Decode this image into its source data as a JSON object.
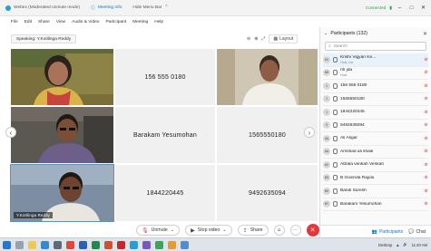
{
  "titlebar": {
    "app_title": "Webex (Moderated unmute mode)",
    "meeting_info": "Meeting Info",
    "hide_menu": "Hide Menu Bar",
    "connected": "Connected",
    "min": "–",
    "max": "□",
    "close": "✕"
  },
  "menubar": {
    "items": [
      "File",
      "Edit",
      "Share",
      "View",
      "Audio & Video",
      "Participant",
      "Meeting",
      "Help"
    ]
  },
  "speaking": "Speaking: Y.Kotilinga Reddy",
  "video_tools": {
    "layout": "Layout"
  },
  "tiles": {
    "t1_label": "",
    "t2_label": "156 555 0180",
    "t3_label": "",
    "t4_label": "Barakam Yesumohan",
    "t5_label": "1565550180",
    "t6_label": "",
    "t7_label": "1844220445",
    "t8_label": "9492635094",
    "active_name": "Y.Kotilinga Reddy"
  },
  "participants": {
    "header": "Participants (132)",
    "search_placeholder": "Search",
    "list": [
      {
        "initials": "KV",
        "name": "Krishi Vigyan Ke...",
        "sub": "Host, me",
        "highlight": true
      },
      {
        "initials": "NR",
        "name": "nh jda",
        "sub": "Host",
        "highlight": false
      },
      {
        "initials": "1",
        "name": "156 555 0180",
        "sub": "",
        "highlight": false
      },
      {
        "initials": "1",
        "name": "1565550180",
        "sub": "",
        "highlight": false
      },
      {
        "initials": "1",
        "name": "1844220445",
        "sub": "",
        "highlight": false
      },
      {
        "initials": "9",
        "name": "9492635094",
        "sub": "",
        "highlight": false
      },
      {
        "initials": "AA",
        "name": "Ali Asgar",
        "sub": "",
        "highlight": false
      },
      {
        "initials": "AA",
        "name": "Amshad ali shaik",
        "sub": "",
        "highlight": false
      },
      {
        "initials": "AV",
        "name": "Attrala venkah Venkah",
        "sub": "",
        "highlight": false
      },
      {
        "initials": "BG",
        "name": "B Govinda Rajulu",
        "sub": "",
        "highlight": false
      },
      {
        "initials": "BS",
        "name": "Bandi Suresh",
        "sub": "",
        "highlight": false
      },
      {
        "initials": "BY",
        "name": "Barakam Yesumohan",
        "sub": "",
        "highlight": false
      }
    ],
    "footer_participants": "Participants",
    "footer_chat": "Chat"
  },
  "controls": {
    "unmute": "Unmute",
    "stop_video": "Stop video",
    "share": "Share"
  },
  "taskbar": {
    "time": "Desktop",
    "clock": "11:40 AM"
  },
  "colors": {
    "accent": "#1b6fc1",
    "end_red": "#e2383a",
    "connected_green": "#2a9d4b",
    "tile_bg": "#f0f0f0"
  }
}
